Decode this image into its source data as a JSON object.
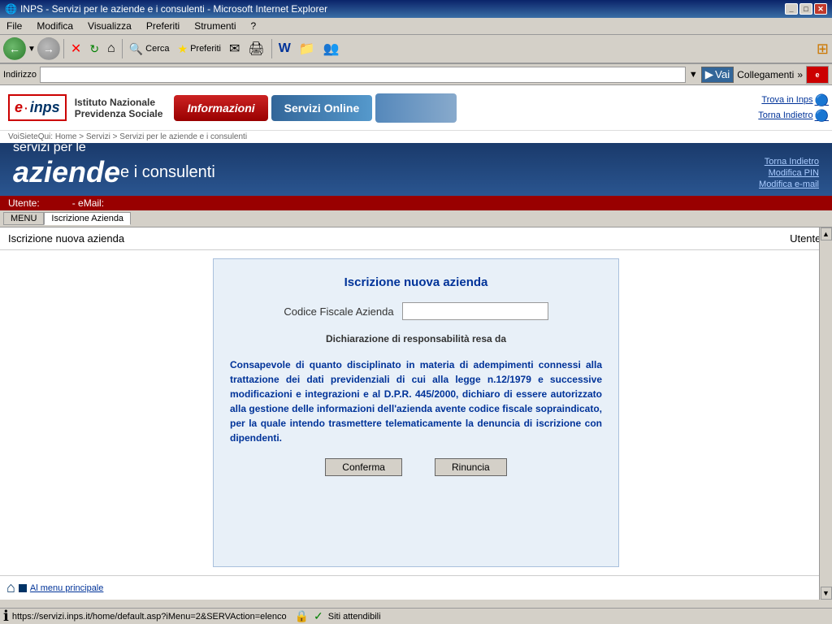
{
  "window": {
    "title": "INPS - Servizi per le aziende e i consulenti - Microsoft Internet Explorer",
    "title_icon": "🌐"
  },
  "menu": {
    "items": [
      "File",
      "Modifica",
      "Visualizza",
      "Preferiti",
      "Strumenti",
      "?"
    ]
  },
  "toolbar": {
    "back_label": "Indietro",
    "forward_label": "",
    "stop_label": "✕",
    "refresh_label": "↻",
    "home_label": "⌂",
    "search_label": "Cerca",
    "favorites_label": "Preferiti",
    "mail_label": "",
    "print_label": ""
  },
  "address_bar": {
    "label": "Indirizzo",
    "url": "",
    "vai_label": "Vai",
    "collegamenti_label": "Collegamenti"
  },
  "inps_header": {
    "logo_text_bold": "e·inps",
    "logo_subtext1": "Istituto Nazionale",
    "logo_subtext2": "Previdenza Sociale",
    "nav_info": "Informazioni",
    "nav_online": "Servizi Online",
    "trova_link": "Trova in Inps",
    "torna_link": "Torna Indietro",
    "breadcrumb": "VoiSieteQui: Home > Servizi > Servizi per le aziende e i consulenti"
  },
  "blue_banner": {
    "title_small": "servizi per le",
    "title_large": "aziende",
    "title_suffix": " e i consulenti",
    "torna_indietro": "Torna Indietro",
    "modifica_pin": "Modifica PIN",
    "modifica_email": "Modifica e-mail"
  },
  "user_bar": {
    "utente_label": "Utente:",
    "utente_value": "",
    "email_label": "- eMail:",
    "email_value": ""
  },
  "nav": {
    "menu_label": "MENU",
    "current_page": "Iscrizione Azienda"
  },
  "content": {
    "header_title": "Iscrizione nuova azienda",
    "header_utente": "Utente:",
    "form_title": "Iscrizione nuova azienda",
    "codice_fiscale_label": "Codice Fiscale Azienda",
    "codice_fiscale_placeholder": "",
    "dichiarazione_title": "Dichiarazione di responsabilità resa da",
    "dichiarazione_text": "Consapevole di quanto disciplinato in materia di adempimenti connessi alla trattazione dei dati previdenziali di cui alla legge n.12/1979 e successive modificazioni e integrazioni e al D.P.R. 445/2000, dichiaro di essere autorizzato alla gestione delle informazioni dell'azienda avente codice fiscale sopraindicato, per la quale intendo trasmettere telematicamente la denuncia di iscrizione con dipendenti.",
    "conferma_label": "Conferma",
    "rinuncia_label": "Rinuncia"
  },
  "bottom": {
    "menu_link": "Al menu principale",
    "status_url": "https://servizi.inps.it/home/default.asp?iMenu=2&SERVAction=elenco",
    "siti_attendibili": "Siti attendibili"
  }
}
